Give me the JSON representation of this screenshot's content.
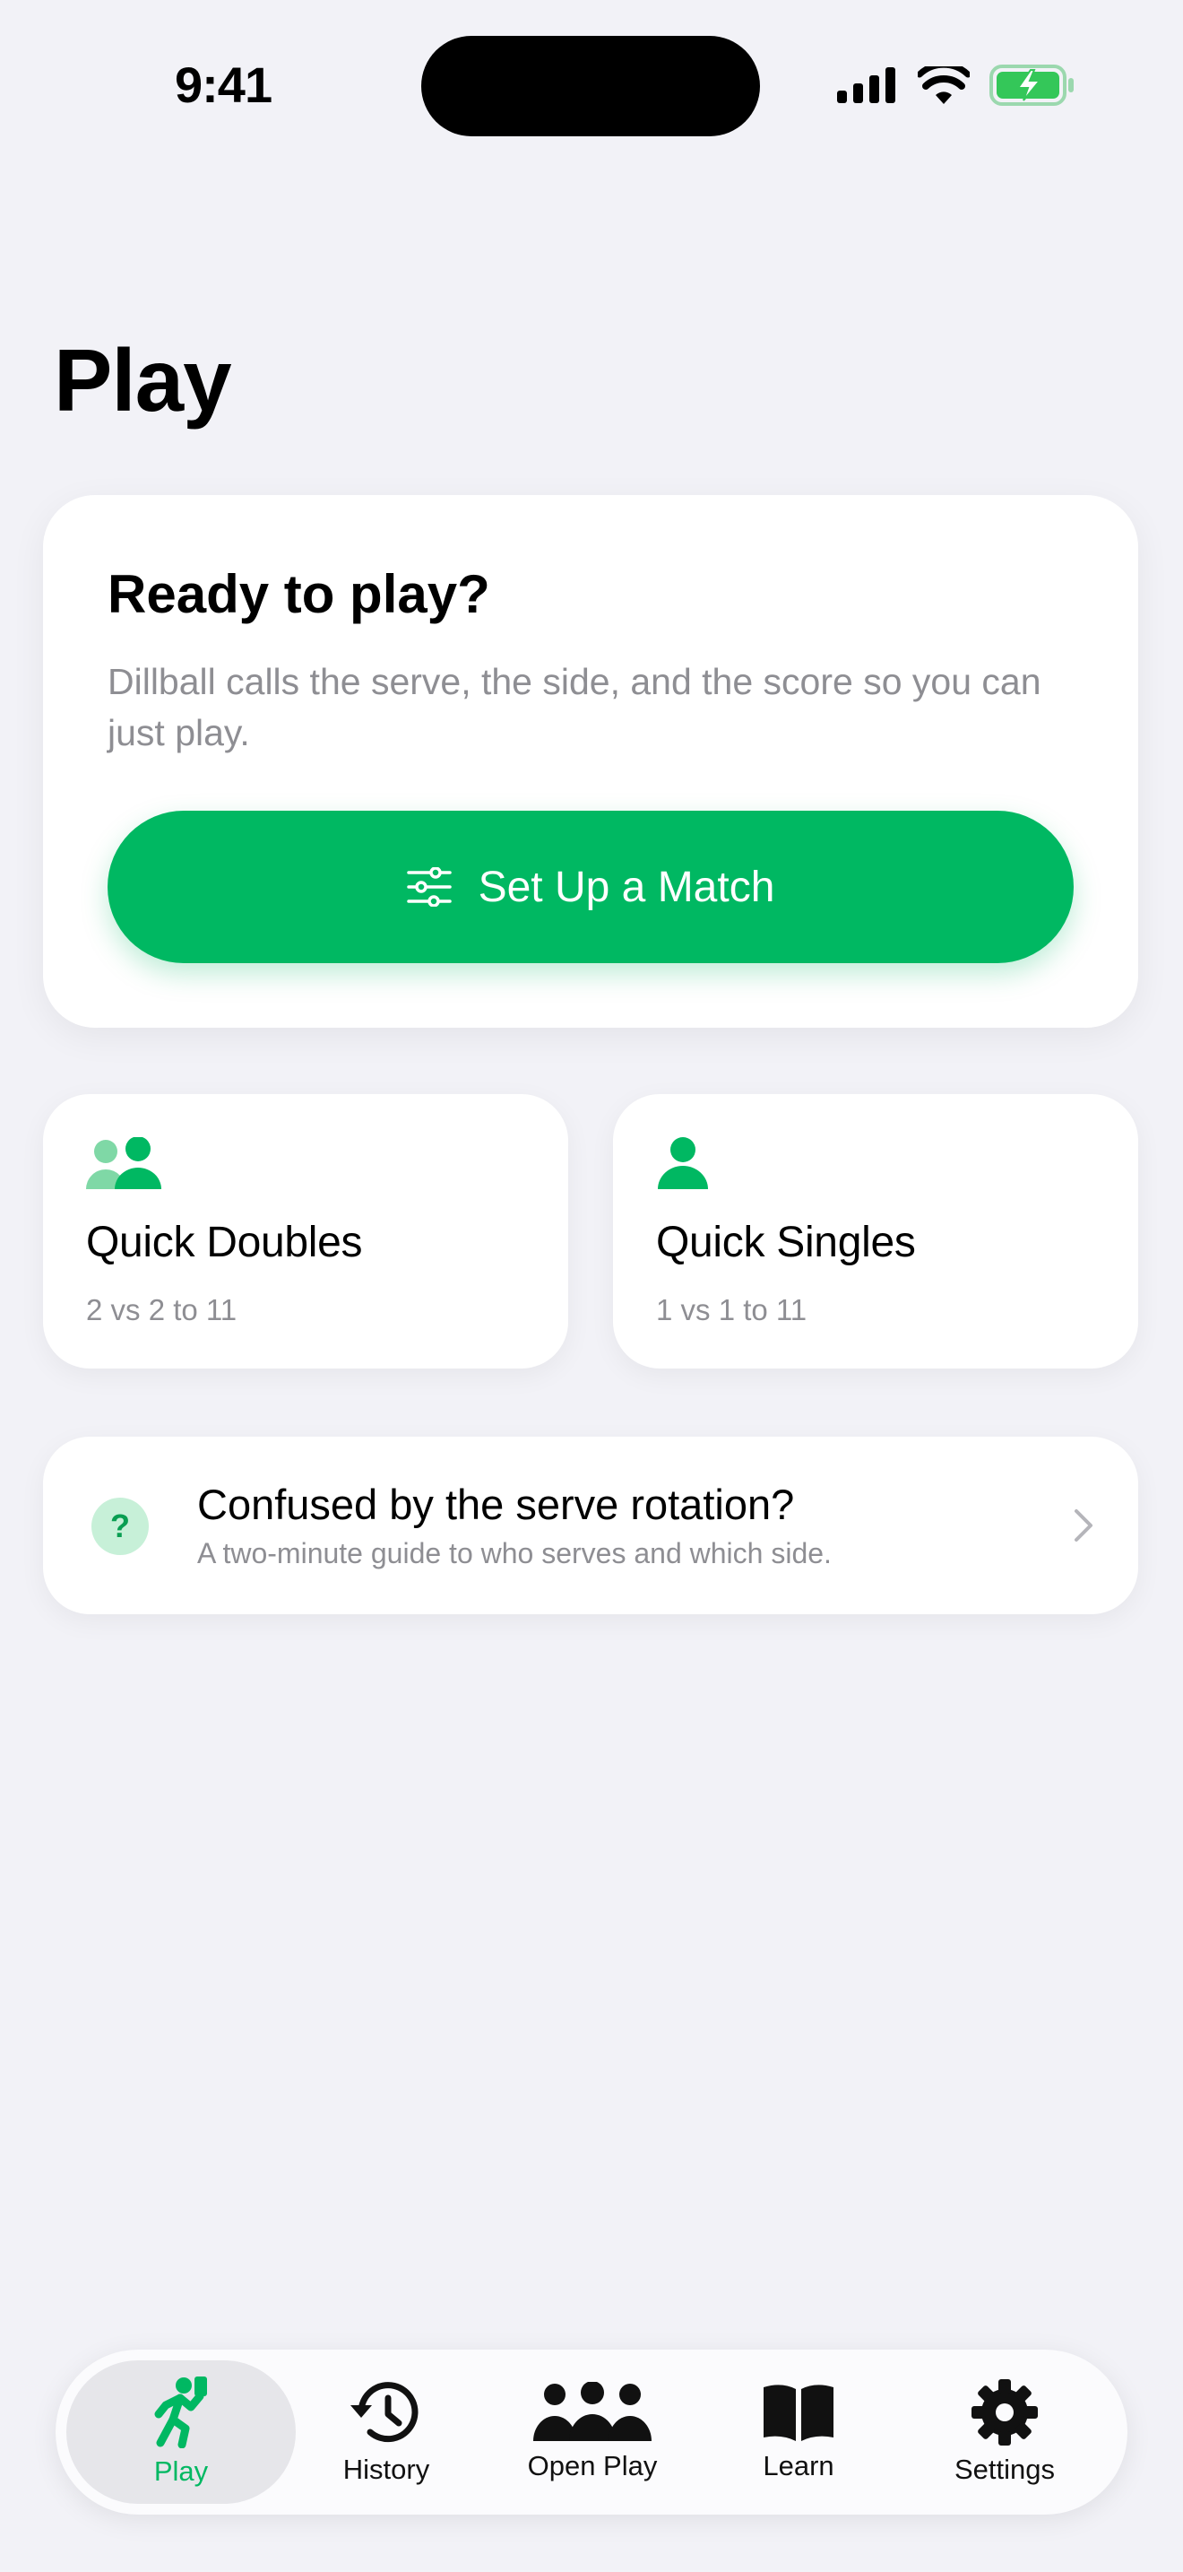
{
  "status_bar": {
    "time": "9:41"
  },
  "page": {
    "title": "Play"
  },
  "hero": {
    "title": "Ready to play?",
    "subtitle": "Dillball calls the serve, the side, and the score so you can just play.",
    "cta_label": "Set Up a Match",
    "accent": "#00B862"
  },
  "quick_cards": [
    {
      "title": "Quick Doubles",
      "subtitle": "2 vs 2 to 11",
      "icon": "two-people-icon"
    },
    {
      "title": "Quick Singles",
      "subtitle": "1 vs 1 to 11",
      "icon": "person-icon"
    }
  ],
  "guide": {
    "badge": "?",
    "title": "Confused by the serve rotation?",
    "subtitle": "A two-minute guide to who serves and which side."
  },
  "tabs": [
    {
      "label": "Play",
      "icon": "running-figure-icon",
      "active": true
    },
    {
      "label": "History",
      "icon": "clock-history-icon",
      "active": false
    },
    {
      "label": "Open Play",
      "icon": "group-icon",
      "active": false
    },
    {
      "label": "Learn",
      "icon": "book-icon",
      "active": false
    },
    {
      "label": "Settings",
      "icon": "gear-icon",
      "active": false
    }
  ]
}
